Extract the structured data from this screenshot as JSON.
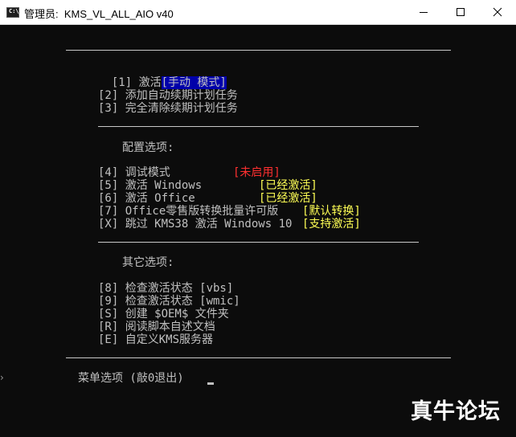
{
  "window": {
    "title": "管理员:  KMS_VL_ALL_AIO v40",
    "icon_label": "C:\\_"
  },
  "menu": {
    "item1_key": "[1] 激活",
    "item1_tag": "[手动 模式]",
    "item2": "[2] 添加自动续期计划任务",
    "item3": "[3] 完全清除续期计划任务",
    "config_heading": "配置选项:",
    "item4_label": "[4] 调试模式",
    "item4_status": "[未启用]",
    "item5_label": "[5] 激活 Windows",
    "item5_status": "[已经激活]",
    "item6_label": "[6] 激活 Office",
    "item6_status": "[已经激活]",
    "item7_label": "[7] Office零售版转换批量许可版",
    "item7_status": "[默认转换]",
    "itemX_label": "[X] 跳过 KMS38 激活 Windows 10",
    "itemX_status": "[支持激活]",
    "other_heading": "其它选项:",
    "item8": "[8] 检查激活状态 [vbs]",
    "item9": "[9] 检查激活状态 [wmic]",
    "itemS": "[S] 创建 $OEM$ 文件夹",
    "itemR": "[R] 阅读脚本自述文档",
    "itemE": "[E] 自定义KMS服务器",
    "prompt": "菜单选项 (敲0退出)"
  },
  "watermark": "真牛论坛",
  "colors": {
    "background": "#0c0c0c",
    "text": "#c0c0c0",
    "highlight_bg": "#0000aa",
    "red": "#ff3030",
    "yellow": "#ffff55"
  }
}
